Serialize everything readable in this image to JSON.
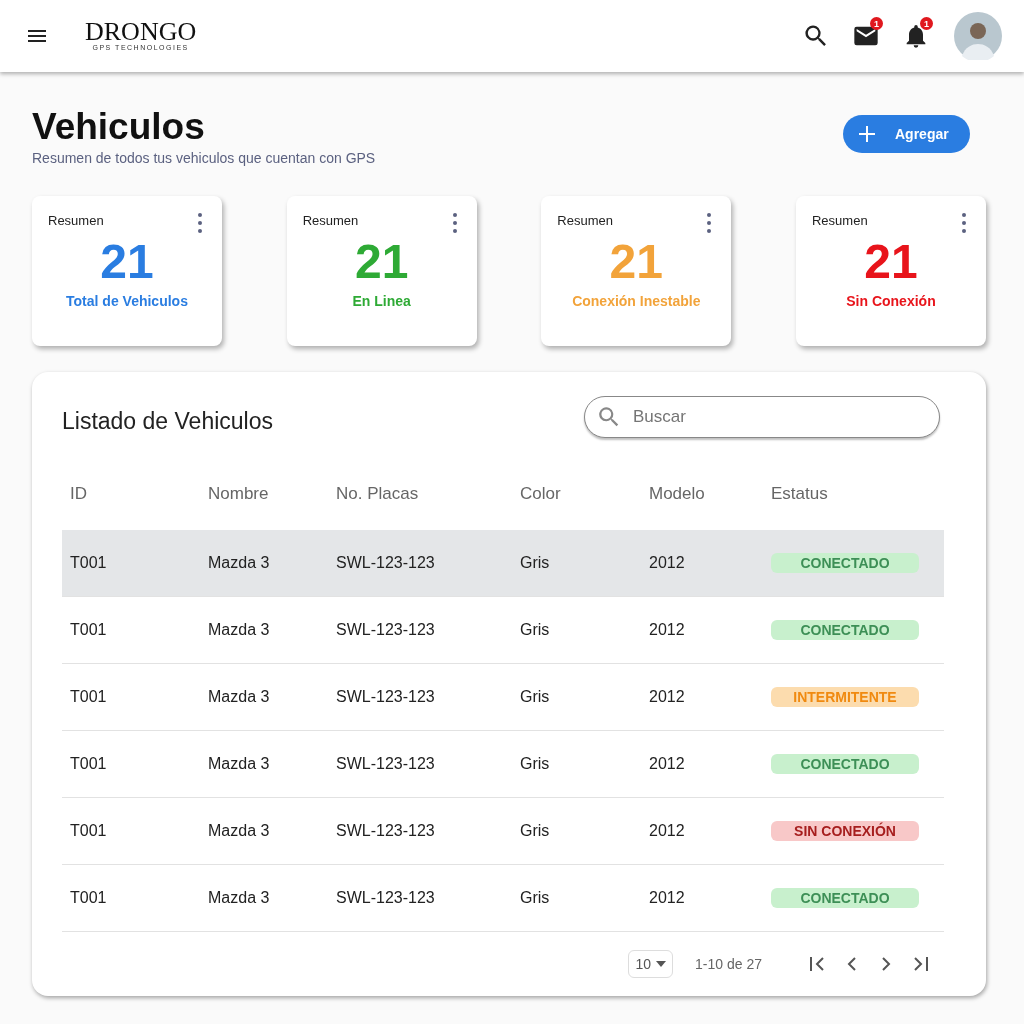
{
  "header": {
    "logo": "DRONGO",
    "logo_tagline": "GPS TECHNOLOGIES",
    "mail_count": "1",
    "notification_count": "1"
  },
  "page": {
    "title": "Vehiculos",
    "subtitle": "Resumen de todos tus vehiculos que cuentan con GPS",
    "add_button": "Agregar"
  },
  "summary_cards": [
    {
      "label": "Resumen",
      "value": "21",
      "caption": "Total de Vehiculos",
      "color": "#2a7de1"
    },
    {
      "label": "Resumen",
      "value": "21",
      "caption": "En Linea",
      "color": "#2eaa35"
    },
    {
      "label": "Resumen",
      "value": "21",
      "caption": "Conexión Inestable",
      "color": "#f2a33a"
    },
    {
      "label": "Resumen",
      "value": "21",
      "caption": "Sin Conexión",
      "color": "#e8141b"
    }
  ],
  "table": {
    "title": "Listado de Vehiculos",
    "search_placeholder": "Buscar",
    "columns": [
      "ID",
      "Nombre",
      "No. Placas",
      "Color",
      "Modelo",
      "Estatus"
    ],
    "rows": [
      {
        "id": "T001",
        "name": "Mazda 3",
        "plates": "SWL-123-123",
        "vehicle_color": "Gris",
        "model": "2012",
        "status": "CONECTADO",
        "kind": "connected",
        "selected": true
      },
      {
        "id": "T001",
        "name": "Mazda 3",
        "plates": "SWL-123-123",
        "vehicle_color": "Gris",
        "model": "2012",
        "status": "CONECTADO",
        "kind": "connected",
        "selected": false
      },
      {
        "id": "T001",
        "name": "Mazda 3",
        "plates": "SWL-123-123",
        "vehicle_color": "Gris",
        "model": "2012",
        "status": "INTERMITENTE",
        "kind": "intermittent",
        "selected": false
      },
      {
        "id": "T001",
        "name": "Mazda 3",
        "plates": "SWL-123-123",
        "vehicle_color": "Gris",
        "model": "2012",
        "status": "CONECTADO",
        "kind": "connected",
        "selected": false
      },
      {
        "id": "T001",
        "name": "Mazda 3",
        "plates": "SWL-123-123",
        "vehicle_color": "Gris",
        "model": "2012",
        "status": "SIN CONEXIÓN",
        "kind": "disconnected",
        "selected": false
      },
      {
        "id": "T001",
        "name": "Mazda 3",
        "plates": "SWL-123-123",
        "vehicle_color": "Gris",
        "model": "2012",
        "status": "CONECTADO",
        "kind": "connected",
        "selected": false
      }
    ]
  },
  "pagination": {
    "page_size": "10",
    "range": "1-10 de 27"
  }
}
